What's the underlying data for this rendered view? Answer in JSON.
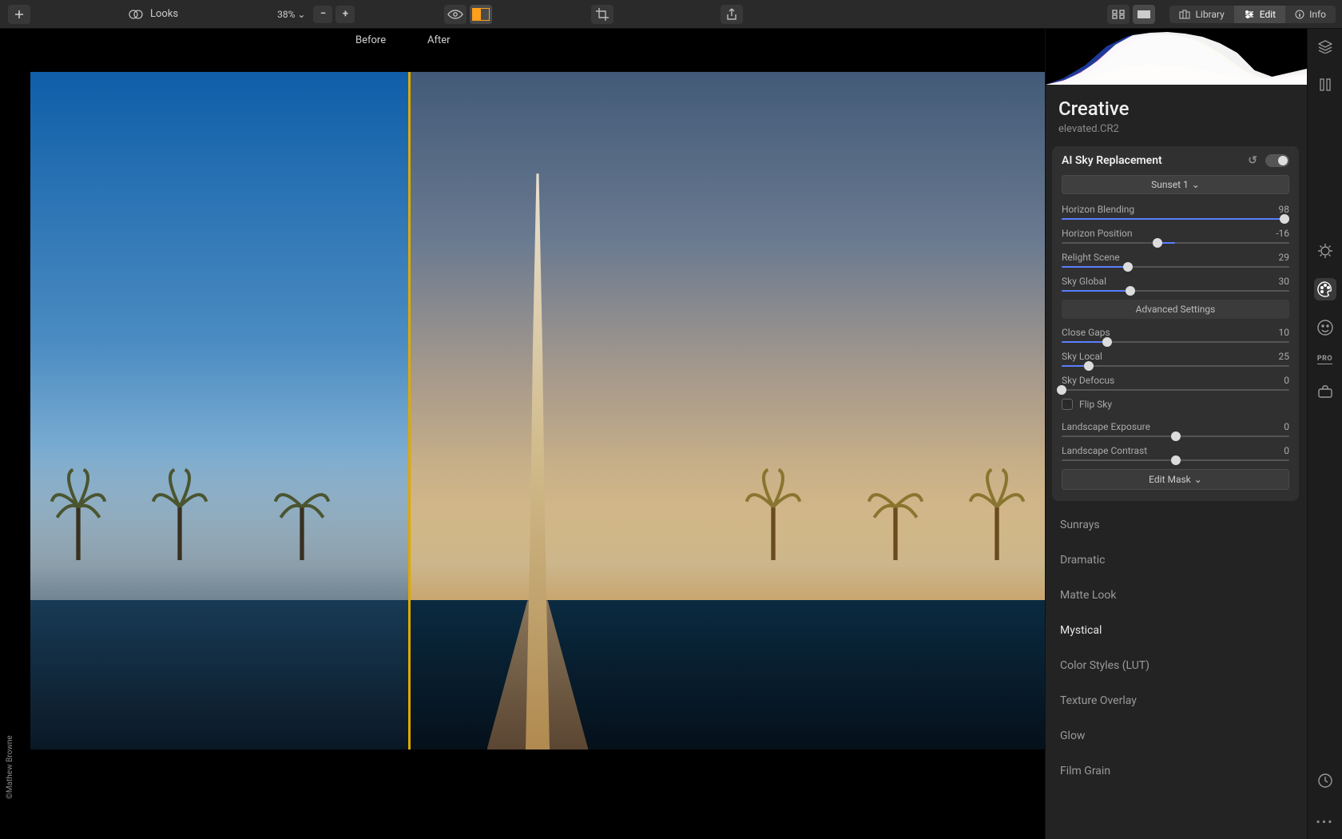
{
  "toolbar": {
    "looks_label": "Looks",
    "zoom_value": "38%",
    "zoom_caret": "⌄",
    "mode_tabs": {
      "library": "Library",
      "edit": "Edit",
      "info": "Info"
    }
  },
  "viewer": {
    "before_label": "Before",
    "after_label": "After",
    "credit": "©Mathew Browne"
  },
  "panel": {
    "category": "Creative",
    "filename": "elevated.CR2",
    "effect_title": "AI Sky Replacement",
    "sky_preset": "Sunset 1",
    "advanced_label": "Advanced Settings",
    "flip_sky_label": "Flip Sky",
    "edit_mask_label": "Edit Mask",
    "sliders": {
      "horizon_blending": {
        "label": "Horizon Blending",
        "value": "98",
        "pct": 98
      },
      "horizon_position": {
        "label": "Horizon Position",
        "value": "-16",
        "pct": 42
      },
      "relight_scene": {
        "label": "Relight Scene",
        "value": "29",
        "pct": 29
      },
      "sky_global": {
        "label": "Sky Global",
        "value": "30",
        "pct": 30
      },
      "close_gaps": {
        "label": "Close Gaps",
        "value": "10",
        "pct": 20
      },
      "sky_local": {
        "label": "Sky Local",
        "value": "25",
        "pct": 12
      },
      "sky_defocus": {
        "label": "Sky Defocus",
        "value": "0",
        "pct": 0
      },
      "landscape_exposure": {
        "label": "Landscape Exposure",
        "value": "0",
        "pct": 50
      },
      "landscape_contrast": {
        "label": "Landscape Contrast",
        "value": "0",
        "pct": 50
      }
    },
    "effects": [
      {
        "name": "Sunrays"
      },
      {
        "name": "Dramatic"
      },
      {
        "name": "Matte Look"
      },
      {
        "name": "Mystical",
        "hl": true
      },
      {
        "name": "Color Styles (LUT)"
      },
      {
        "name": "Texture Overlay"
      },
      {
        "name": "Glow"
      },
      {
        "name": "Film Grain"
      }
    ]
  },
  "strip": {
    "pro_label": "PRO"
  }
}
